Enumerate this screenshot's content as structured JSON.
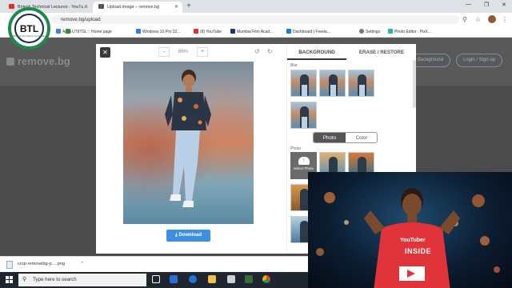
{
  "browser": {
    "tabs": [
      {
        "title": "Brijesh Technical Lectures - YouTu…",
        "icon": "youtube-icon"
      },
      {
        "title": "Upload Image – remove.bg",
        "icon": "removebg-icon"
      }
    ],
    "new_tab": "+",
    "url": "remove.bg/upload",
    "bookmarks": [
      {
        "label": "Apps"
      },
      {
        "label": "UTIITSL :: Home page"
      },
      {
        "label": "Windows 10 Pro 32…"
      },
      {
        "label": "(8) YouTube"
      },
      {
        "label": "Mumbai Film Acad…"
      },
      {
        "label": "Dashboard | Freela…"
      },
      {
        "label": "Settings"
      },
      {
        "label": "Photo Editor : Pixlr…"
      }
    ]
  },
  "site": {
    "logo": "remove.bg",
    "header_buttons": [
      "Background",
      "Login / Sign up"
    ]
  },
  "editor": {
    "zoom_minus": "−",
    "zoom_value": "86%",
    "zoom_plus": "+",
    "download_label": "⤓ Download",
    "panel_tabs": [
      "BACKGROUND",
      "ERASE / RESTORE"
    ],
    "section_blur": "Blur",
    "section_photo": "Photo",
    "toggle": [
      "Photo",
      "Color"
    ],
    "select_photo": "Select Photo"
  },
  "download_shelf": {
    "file": "crop-removebg-p….png"
  },
  "taskbar": {
    "search_placeholder": "Type here to search"
  },
  "overlay": {
    "brand": "BTL",
    "brand_sub": "BRIJESH TECHNICAL LECTURES",
    "shirt_text_1": "YouTuber",
    "shirt_text_2": "INSIDE"
  }
}
